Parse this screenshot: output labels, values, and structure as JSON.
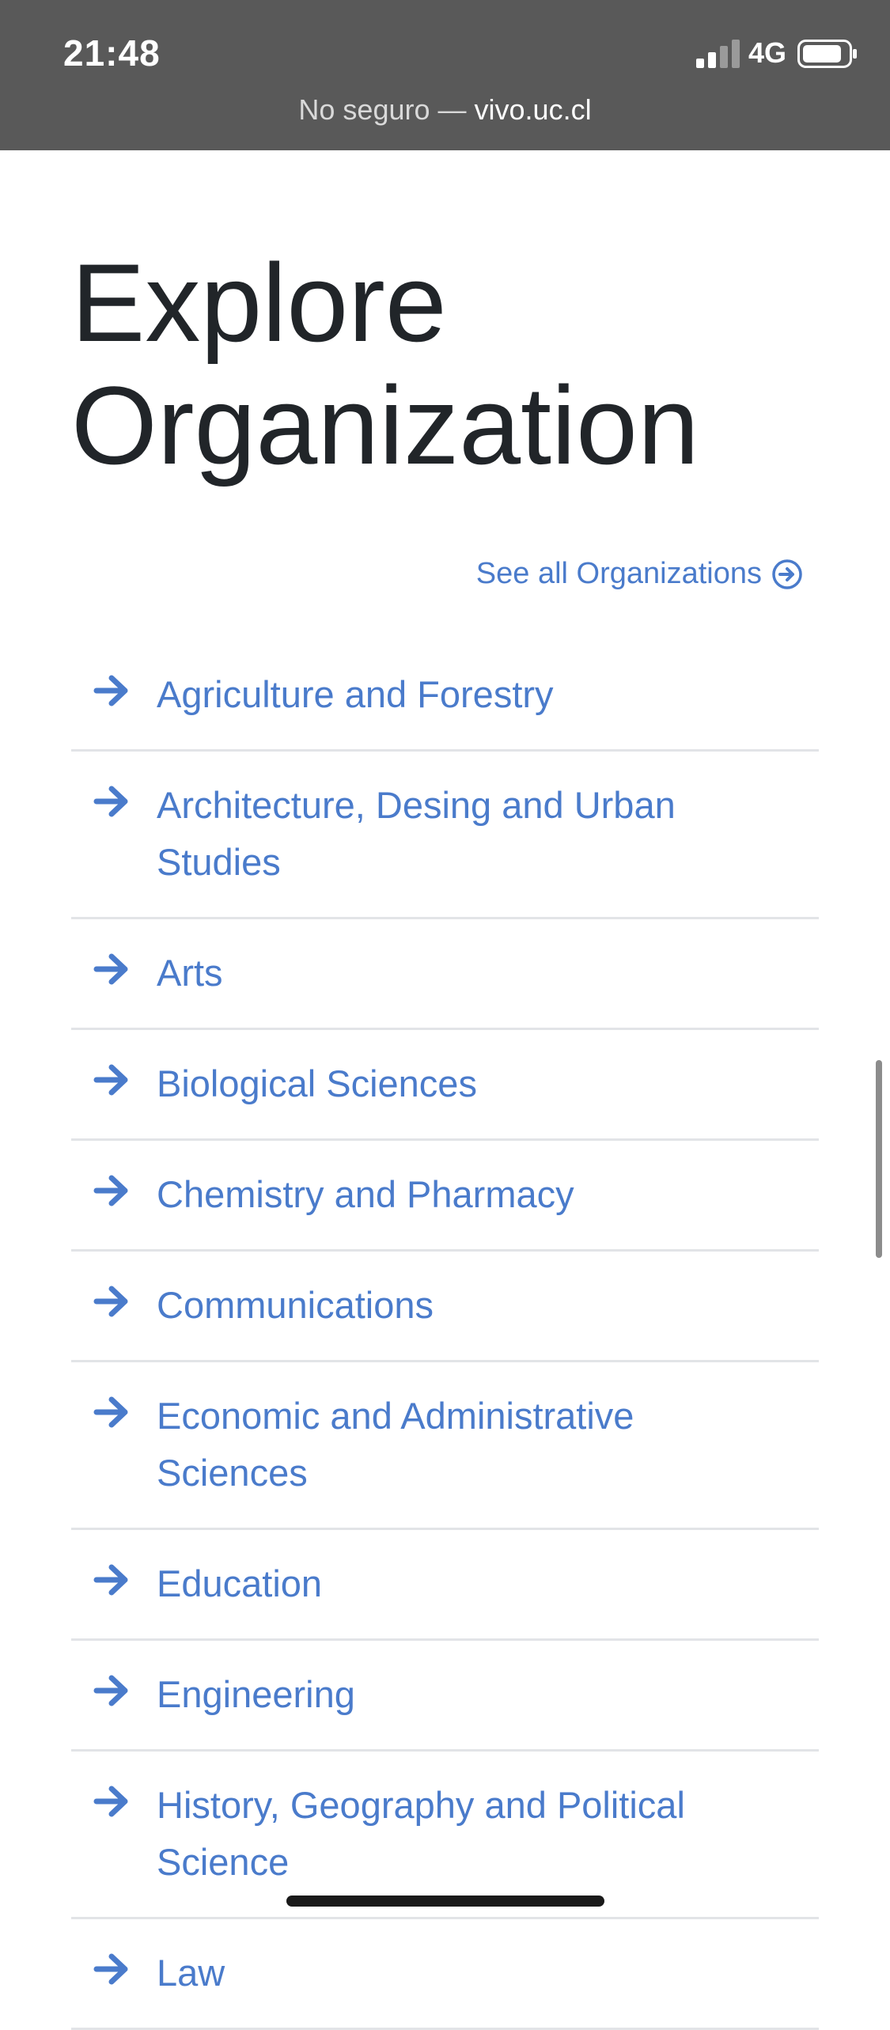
{
  "status_bar": {
    "time": "21:48",
    "network": "4G",
    "url_prefix": "No seguro —",
    "url_host": "vivo.uc.cl"
  },
  "page": {
    "title_line1": "Explore",
    "title_line2": "Organization",
    "see_all_label": "See all Organizations"
  },
  "organizations": [
    {
      "label": "Agriculture and Forestry"
    },
    {
      "label": "Architecture, Desing and Urban Studies"
    },
    {
      "label": "Arts"
    },
    {
      "label": "Biological Sciences"
    },
    {
      "label": "Chemistry and Pharmacy"
    },
    {
      "label": "Communications"
    },
    {
      "label": "Economic and Administrative Sciences"
    },
    {
      "label": "Education"
    },
    {
      "label": "Engineering"
    },
    {
      "label": "History, Geography and Political Science"
    },
    {
      "label": "Law"
    }
  ],
  "colors": {
    "link": "#4a7bcb",
    "status_bar": "#595959",
    "title": "#212529",
    "divider": "#e2e4e7"
  },
  "icons": {
    "item_arrow": "arrow-right-icon",
    "see_all": "circle-arrow-right-icon"
  }
}
